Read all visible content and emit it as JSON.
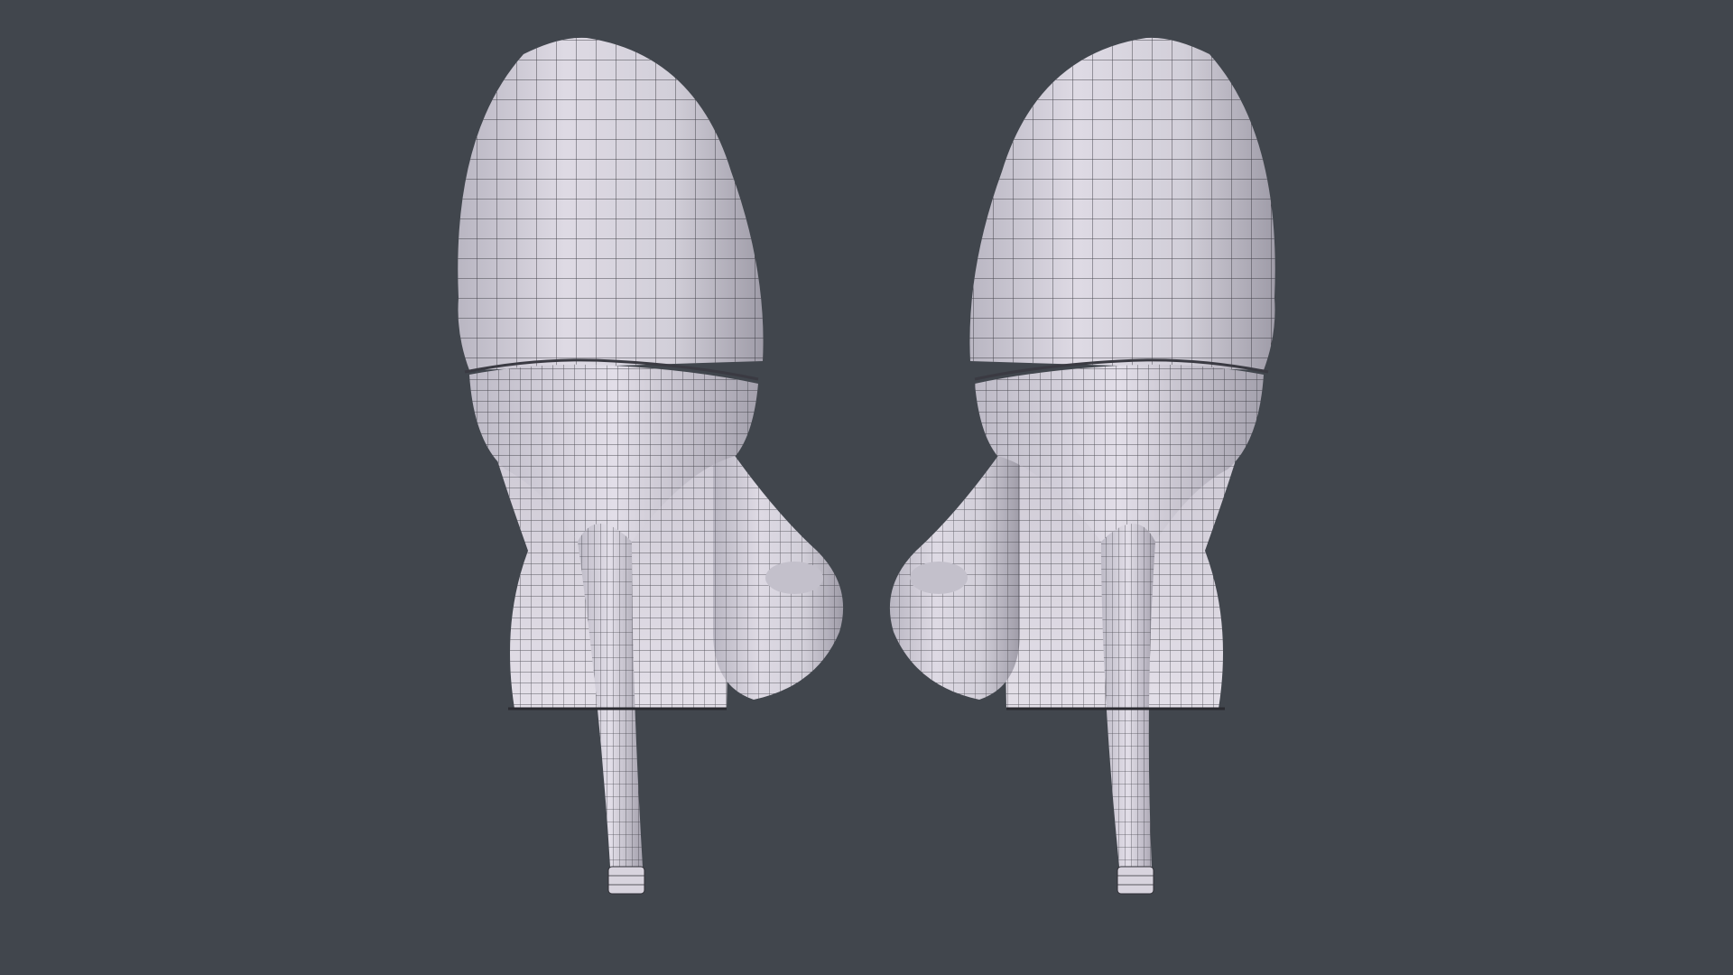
{
  "scene": {
    "background_color": "#41464d",
    "mesh_color": "#dcd8e2",
    "mesh_shadow_color": "#a9a6b1",
    "wire_color": "#2a2a30"
  },
  "objects": [
    {
      "name": "left-high-heel-pump",
      "view": "back",
      "mode": "wireframe-on-shaded"
    },
    {
      "name": "right-high-heel-pump",
      "view": "back",
      "mode": "wireframe-on-shaded"
    }
  ]
}
